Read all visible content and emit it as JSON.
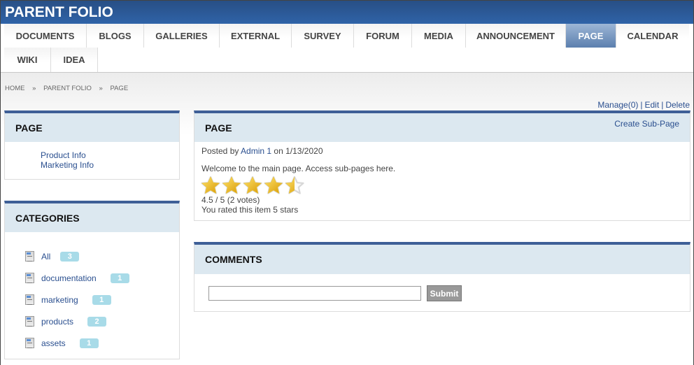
{
  "header": {
    "title": "PARENT FOLIO"
  },
  "nav": {
    "row1": [
      {
        "label": "DOCUMENTS",
        "active": false
      },
      {
        "label": "BLOGS",
        "active": false
      },
      {
        "label": "GALLERIES",
        "active": false
      },
      {
        "label": "EXTERNAL",
        "active": false
      },
      {
        "label": "SURVEY",
        "active": false
      },
      {
        "label": "FORUM",
        "active": false
      },
      {
        "label": "MEDIA",
        "active": false
      },
      {
        "label": "ANNOUNCEMENT",
        "active": false
      },
      {
        "label": "PAGE",
        "active": true
      },
      {
        "label": "CALENDAR",
        "active": false
      }
    ],
    "row2": [
      {
        "label": "WIKI",
        "active": false
      },
      {
        "label": "IDEA",
        "active": false
      }
    ]
  },
  "breadcrumb": {
    "items": [
      "HOME",
      "PARENT FOLIO",
      "PAGE"
    ],
    "separator": "»"
  },
  "actions": {
    "manage": "Manage(0)",
    "edit": "Edit",
    "delete": "Delete",
    "separator": "|"
  },
  "page_panel": {
    "title": "PAGE",
    "links": [
      "Product Info",
      "Marketing Info"
    ]
  },
  "categories": {
    "title": "CATEGORIES",
    "items": [
      {
        "label": "All",
        "count": "3",
        "icon": "document-icon"
      },
      {
        "label": "documentation",
        "count": "1",
        "icon": "document-icon"
      },
      {
        "label": "marketing",
        "count": "1",
        "icon": "document-icon"
      },
      {
        "label": "products",
        "count": "2",
        "icon": "document-icon"
      },
      {
        "label": "assets",
        "count": "1",
        "icon": "document-icon"
      }
    ]
  },
  "main": {
    "title": "PAGE",
    "create_link": "Create Sub-Page",
    "posted_prefix": "Posted by",
    "author": "Admin 1",
    "posted_on": "on 1/13/2020",
    "body": "Welcome to the main page. Access sub-pages here.",
    "rating": {
      "value": 4.5,
      "max": 5,
      "summary": "4.5 / 5 (2 votes)",
      "user_rating_text": "You rated this item 5 stars"
    }
  },
  "comments": {
    "title": "COMMENTS",
    "input_value": "",
    "submit_label": "Submit"
  },
  "colors": {
    "header_blue": "#2f63a8",
    "panel_border": "#3e5f97",
    "panel_head_bg": "#dce8f0",
    "link": "#2a4f8f",
    "badge": "#a8dbe8",
    "active_tab": "#5b7fae",
    "star_gold": "#f2c21a"
  }
}
